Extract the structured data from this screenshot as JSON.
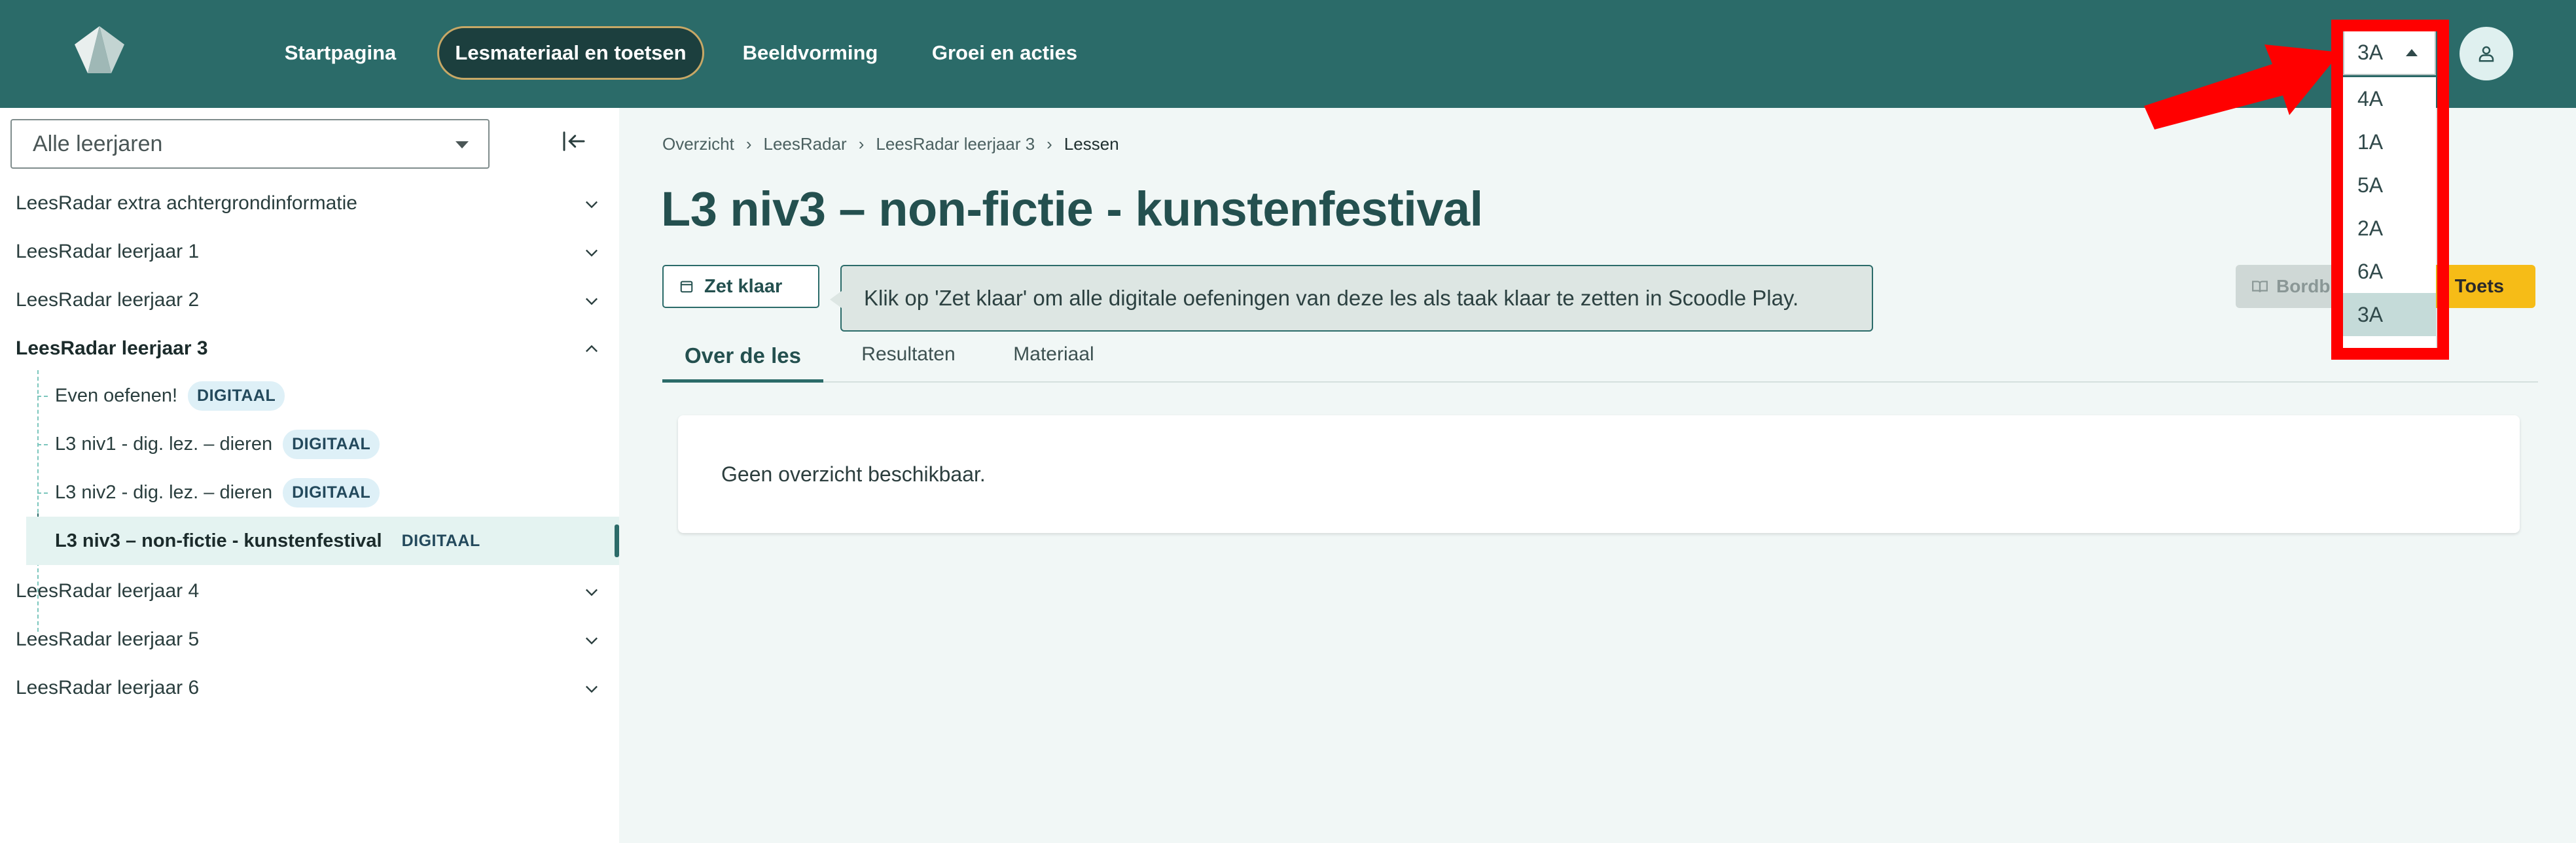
{
  "nav": {
    "items": [
      "Startpagina",
      "Lesmateriaal en toetsen",
      "Beeldvorming",
      "Groei en acties"
    ],
    "active": "Lesmateriaal en toetsen"
  },
  "class_select": {
    "value": "3A",
    "options": [
      "4A",
      "1A",
      "5A",
      "2A",
      "6A",
      "3A"
    ],
    "selected": "3A"
  },
  "sidebar": {
    "year_filter": "Alle leerjaren",
    "items": [
      {
        "label": "LeesRadar extra achtergrondinformatie"
      },
      {
        "label": "LeesRadar leerjaar 1"
      },
      {
        "label": "LeesRadar leerjaar 2"
      },
      {
        "label": "LeesRadar leerjaar 3"
      },
      {
        "label": "LeesRadar leerjaar 4"
      },
      {
        "label": "LeesRadar leerjaar 5"
      },
      {
        "label": "LeesRadar leerjaar 6"
      }
    ],
    "sub_items": [
      {
        "label": "Even oefenen!",
        "badge": "DIGITAAL"
      },
      {
        "label": "L3 niv1 - dig. lez. – dieren",
        "badge": "DIGITAAL"
      },
      {
        "label": "L3 niv2 - dig. lez. – dieren",
        "badge": "DIGITAAL"
      },
      {
        "label": "L3 niv3 – non-fictie - kunstenfestival",
        "badge": "DIGITAAL"
      }
    ]
  },
  "breadcrumb": [
    "Overzicht",
    "LeesRadar",
    "LeesRadar leerjaar 3",
    "Lessen"
  ],
  "page": {
    "title": "L3 niv3 – non-fictie - kunstenfestival",
    "zet_klaar": "Zet klaar",
    "tooltip": "Klik op 'Zet klaar' om alle digitale oefeningen van deze les als taak klaar te zetten in Scoodle Play.",
    "bordboek": "Bordb",
    "toets": "Toets",
    "tabs": [
      "Over de les",
      "Resultaten",
      "Materiaal"
    ],
    "active_tab": "Over de les",
    "overview_text": "Geen overzicht beschikbaar."
  },
  "colors": {
    "header": "#2b6b69",
    "accent": "#f6bc17",
    "highlight_annotation": "#ff0000"
  }
}
